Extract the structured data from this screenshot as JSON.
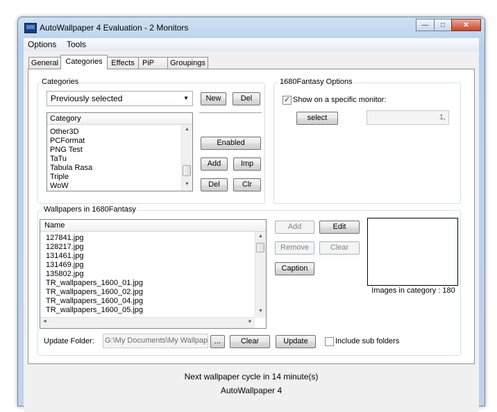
{
  "window": {
    "title": "AutoWallpaper 4 Evaluation - 2 Monitors",
    "minimize_glyph": "—",
    "maximize_glyph": "□",
    "close_glyph": "✕"
  },
  "menu": [
    "Options",
    "Tools"
  ],
  "tabs": [
    {
      "label": "General",
      "active": false
    },
    {
      "label": "Categories",
      "active": true
    },
    {
      "label": "Effects",
      "active": false
    },
    {
      "label": "PiP",
      "active": false
    },
    {
      "label": "Groupings",
      "active": false
    }
  ],
  "categories_group": {
    "title": "Categories",
    "filter_value": "Previously selected",
    "new_label": "New",
    "del_label": "Del",
    "list_header": "Category",
    "items": [
      "Other3D",
      "PCFormat",
      "PNG Test",
      "TaTu",
      "Tabula Rasa",
      "Triple",
      "WoW"
    ],
    "enabled_label": "Enabled",
    "add_label": "Add",
    "imp_label": "Imp",
    "del2_label": "Del",
    "clr_label": "Clr"
  },
  "options_group": {
    "title": "1680Fantasy Options",
    "show_monitor_label": "Show on a specific monitor:",
    "show_monitor_checked": true,
    "select_label": "select",
    "monitor_value": "1,"
  },
  "wallpapers_group": {
    "title": "Wallpapers in 1680Fantasy",
    "list_header": "Name",
    "files": [
      "127841.jpg",
      "128217.jpg",
      "131461.jpg",
      "131469.jpg",
      "135802.jpg",
      "TR_wallpapers_1600_01.jpg",
      "TR_wallpapers_1600_02.jpg",
      "TR_wallpapers_1600_04.jpg",
      "TR_wallpapers_1600_05.jpg"
    ],
    "add_label": "Add",
    "edit_label": "Edit",
    "remove_label": "Remove",
    "clear_label": "Clear",
    "caption_label": "Caption",
    "images_count_text": "Images in category : 180",
    "update_folder_label": "Update Folder:",
    "folder_value": "G:\\My Documents\\My Wallpape",
    "browse_label": "...",
    "clear2_label": "Clear",
    "update_label": "Update",
    "include_sub_label": "Include sub folders",
    "include_sub_checked": false
  },
  "status": {
    "next_cycle": "Next wallpaper cycle in 14 minute(s)",
    "app_name": "AutoWallpaper 4"
  },
  "icons": {
    "scroll_up": "▲",
    "scroll_down": "▼",
    "scroll_left": "◄",
    "scroll_right": "►",
    "combo_arrow": "▼",
    "check": "✓"
  }
}
